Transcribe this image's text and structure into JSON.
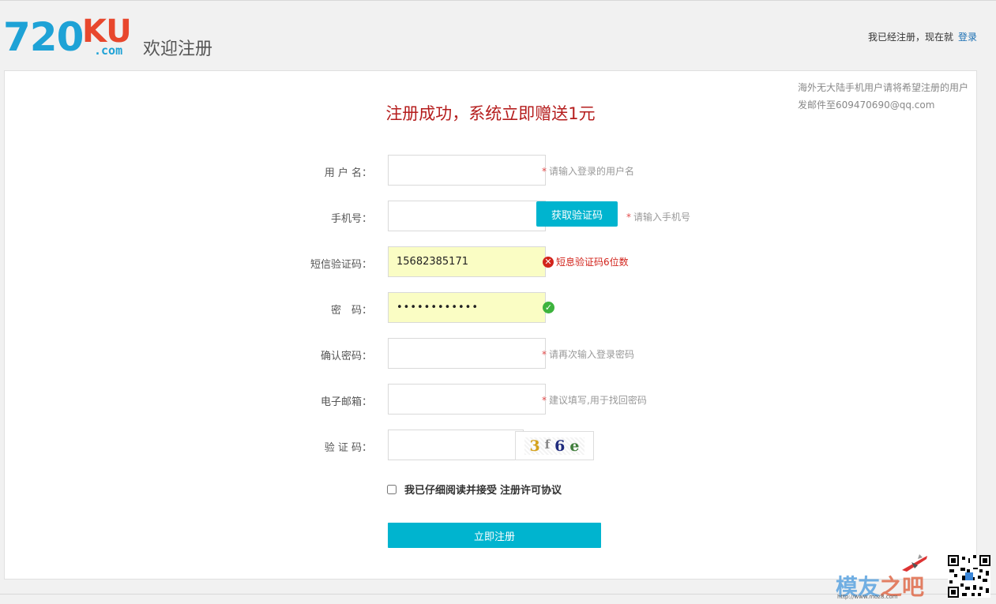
{
  "header": {
    "logo_main": "720",
    "logo_ku": "KU",
    "logo_com": ".com",
    "welcome": "欢迎注册",
    "already_text": "我已经注册，现在就",
    "login_link": "登录"
  },
  "notice": {
    "line1": "海外无大陆手机用户请将希望注册的用户",
    "line2": "发邮件至609470690@qq.com"
  },
  "form": {
    "success_message": "注册成功，系统立即赠送1元",
    "username": {
      "label": "用 户 名：",
      "value": "",
      "hint": "请输入登录的用户名"
    },
    "phone": {
      "label": "手机号：",
      "value": "",
      "button": "获取验证码",
      "hint": "请输入手机号"
    },
    "sms_code": {
      "label": "短信验证码：",
      "value": "15682385171",
      "error": "短息验证码6位数"
    },
    "password": {
      "label": "密　码：",
      "value": "••••••••••••"
    },
    "confirm_password": {
      "label": "确认密码：",
      "value": "",
      "hint": "请再次输入登录密码"
    },
    "email": {
      "label": "电子邮箱：",
      "value": "",
      "hint": "建议填写,用于找回密码"
    },
    "captcha": {
      "label": "验 证 码：",
      "value": "",
      "chars": [
        "3",
        "f",
        "6",
        "e"
      ]
    },
    "agree_text": "我已仔细阅读并接受",
    "agree_link": "注册许可协议",
    "submit": "立即注册",
    "required_mark": "*"
  },
  "watermark": {
    "brand_a": "模友",
    "brand_b": "之吧",
    "url": "http://www.moz8.com"
  },
  "colors": {
    "accent": "#00b4cf",
    "logo_blue": "#1ea2d6",
    "logo_red": "#e8472d",
    "error": "#d2241c",
    "success_text": "#b51d1d",
    "autofill_yellow": "#fafdc4"
  }
}
